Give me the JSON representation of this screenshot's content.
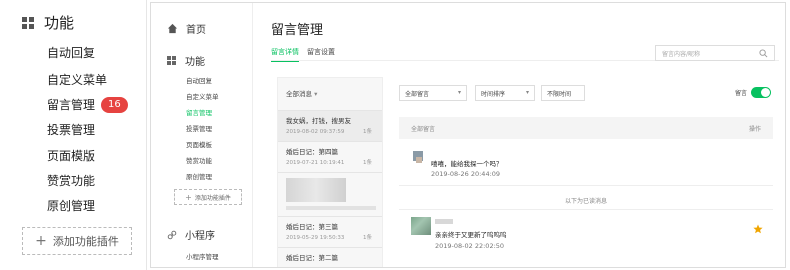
{
  "left_menu": {
    "title": "功能",
    "items": [
      {
        "label": "自动回复"
      },
      {
        "label": "自定义菜单"
      },
      {
        "label": "留言管理",
        "badge": "16"
      },
      {
        "label": "投票管理"
      },
      {
        "label": "页面模版"
      },
      {
        "label": "赞赏功能"
      },
      {
        "label": "原创管理"
      }
    ],
    "add_plugin": "添加功能插件"
  },
  "nav": {
    "home": "首页",
    "func": "功能",
    "sub_items": [
      "自动回复",
      "自定义菜单",
      "留言管理",
      "投票管理",
      "页面模板",
      "赞赏功能",
      "原创管理"
    ],
    "active_index": 2,
    "add_plugin": "添加功能插件",
    "miniprogram": "小程序",
    "miniprogram_sub": "小程序管理"
  },
  "page": {
    "title": "留言管理",
    "tabs": [
      "留言详情",
      "留言设置"
    ],
    "active_tab": 0,
    "search_placeholder": "留言内容/昵称"
  },
  "list": {
    "filter": "全部消息",
    "items": [
      {
        "title": "我女娲，打钱，搜男友",
        "date": "2019-08-02 09:37:59",
        "count": "1条",
        "selected": true
      },
      {
        "title": "婚后日记：第四篇",
        "date": "2019-07-21 10:19:41",
        "count": "1条"
      },
      {
        "title": "婚后日记：第三篇",
        "date": "2019-05-29 19:50:33",
        "count": "1条"
      },
      {
        "title": "婚后日记：第二篇",
        "date": "",
        "count": ""
      }
    ]
  },
  "detail": {
    "dropdowns": [
      "全部留言",
      "时间排序",
      "不限时间"
    ],
    "toggle_label": "留言",
    "toggle_on": true,
    "header_left": "全部留言",
    "header_right": "操作",
    "messages": [
      {
        "text": "嘻嘻，能给我探一个吗？",
        "time": "2019-08-26 20:44:09"
      },
      {
        "text": "亲亲终于又更新了呜呜呜",
        "time": "2019-08-02 22:02:50",
        "starred": true
      }
    ],
    "read_note": "以下为已读消息"
  },
  "colors": {
    "accent": "#07c160",
    "badge": "#e64340",
    "star": "#f0a500"
  }
}
